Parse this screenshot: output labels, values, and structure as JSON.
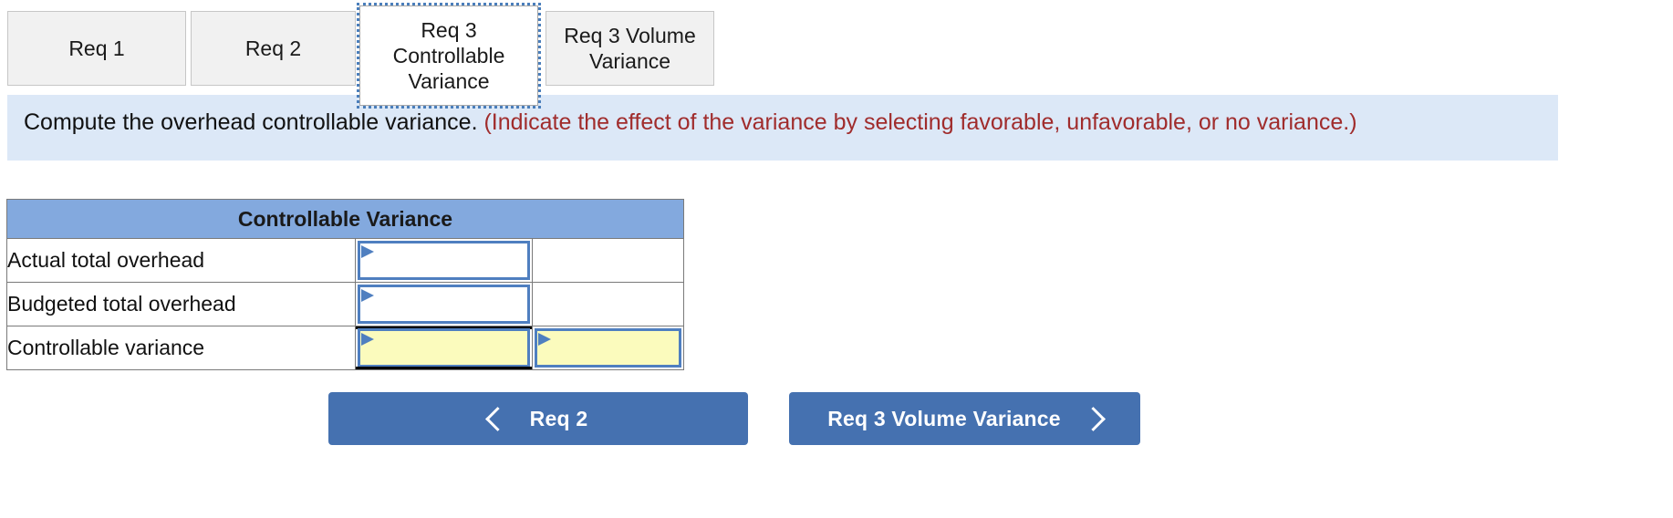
{
  "tabs": [
    {
      "label": "Req 1",
      "active": false
    },
    {
      "label": "Req 2",
      "active": false
    },
    {
      "label": "Req 3 Controllable Variance",
      "active": true
    },
    {
      "label": "Req 3 Volume Variance",
      "active": false
    }
  ],
  "banner": {
    "prompt": "Compute the overhead controllable variance.",
    "hint": "(Indicate the effect of the variance by selecting favorable, unfavorable, or no variance.)"
  },
  "table": {
    "header": "Controllable Variance",
    "rows": [
      {
        "label": "Actual total overhead",
        "amount": "",
        "effect": "",
        "amount_editable": true,
        "effect_editable": false,
        "highlight": false,
        "total": false
      },
      {
        "label": "Budgeted total overhead",
        "amount": "",
        "effect": "",
        "amount_editable": true,
        "effect_editable": false,
        "highlight": false,
        "total": false
      },
      {
        "label": "Controllable variance",
        "amount": "",
        "effect": "",
        "amount_editable": true,
        "effect_editable": true,
        "highlight": true,
        "total": true
      }
    ]
  },
  "nav": {
    "prev_label": "Req 2",
    "next_label": "Req 3 Volume Variance",
    "prev_icon": "chevron-left-icon",
    "next_icon": "chevron-right-icon"
  },
  "colors": {
    "table_header": "#83a9de",
    "banner_bg": "#dce8f7",
    "hint_text": "#a02c2c",
    "button": "#4571b0",
    "input_border": "#4f7fc0",
    "highlight_cell": "#fbfbbd",
    "focus_outline": "#4a7ebb"
  }
}
